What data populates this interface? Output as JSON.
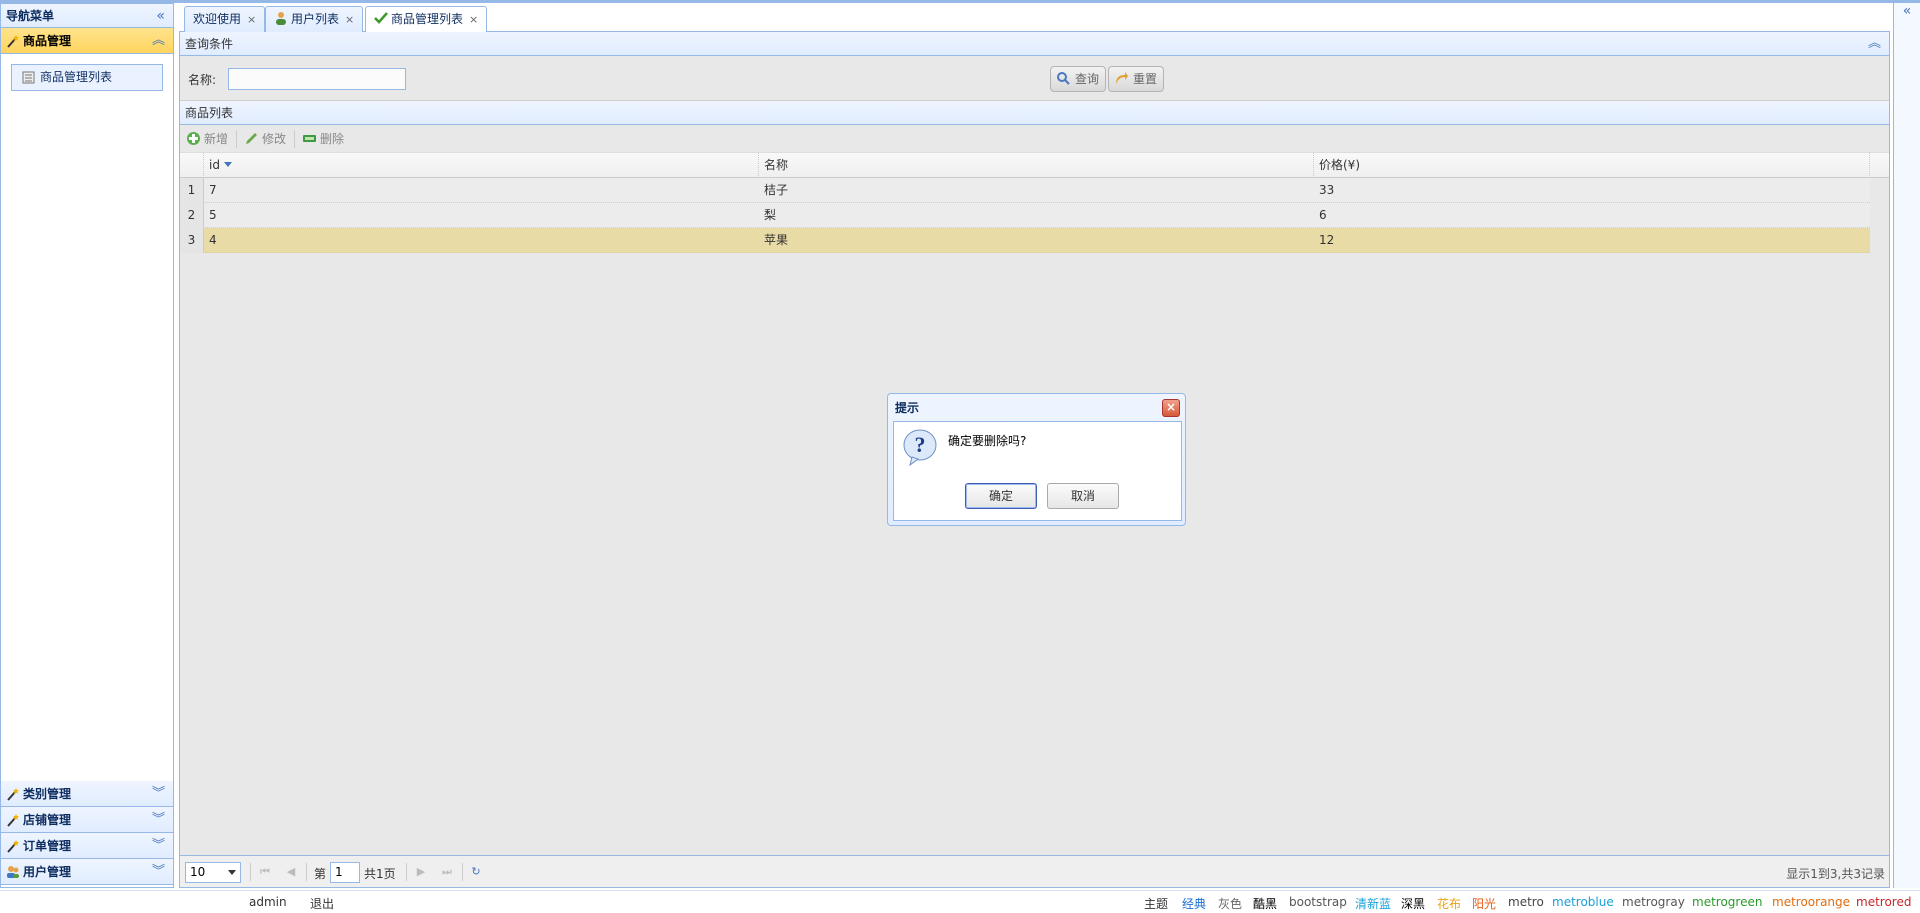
{
  "nav": {
    "title": "导航菜单",
    "sections": [
      {
        "label": "商品管理"
      },
      {
        "label": "类别管理"
      },
      {
        "label": "店铺管理"
      },
      {
        "label": "订单管理"
      },
      {
        "label": "用户管理"
      }
    ],
    "links": [
      {
        "label": "商品管理列表"
      }
    ]
  },
  "tabs": [
    {
      "label": "欢迎使用"
    },
    {
      "label": "用户列表"
    },
    {
      "label": "商品管理列表"
    }
  ],
  "query": {
    "title": "查询条件",
    "name_label": "名称:",
    "name_value": "",
    "search_label": "查询",
    "reset_label": "重置"
  },
  "list": {
    "title": "商品列表",
    "add_label": "新增",
    "edit_label": "修改",
    "delete_label": "删除",
    "columns": [
      "id",
      "名称",
      "价格(¥)"
    ],
    "rows": [
      {
        "num": "1",
        "id": "7",
        "name": "桔子",
        "price": "33"
      },
      {
        "num": "2",
        "id": "5",
        "name": "梨",
        "price": "6"
      },
      {
        "num": "3",
        "id": "4",
        "name": "苹果",
        "price": "12"
      }
    ]
  },
  "pager": {
    "page_size": "10",
    "page_prefix": "第",
    "page_num": "1",
    "page_total": "共1页",
    "info": "显示1到3,共3记录"
  },
  "dialog": {
    "title": "提示",
    "message": "确定要删除吗?",
    "ok_label": "确定",
    "cancel_label": "取消"
  },
  "footer": {
    "user": "admin",
    "logout": "退出",
    "theme_label": "主题",
    "themes": [
      {
        "label": "经典",
        "color": "#1a6fd1"
      },
      {
        "label": "灰色",
        "color": "#666666"
      },
      {
        "label": "酷黑",
        "color": "#000000"
      },
      {
        "label": "bootstrap",
        "color": "#555555"
      },
      {
        "label": "清新蓝",
        "color": "#1aa0d8"
      },
      {
        "label": "深黑",
        "color": "#000000"
      },
      {
        "label": "花布",
        "color": "#e8a317"
      },
      {
        "label": "阳光",
        "color": "#e85a17"
      },
      {
        "label": "metro",
        "color": "#444444"
      },
      {
        "label": "metroblue",
        "color": "#1aa0d8"
      },
      {
        "label": "metrogray",
        "color": "#555555"
      },
      {
        "label": "metrogreen",
        "color": "#2a9a2a"
      },
      {
        "label": "metroorange",
        "color": "#e06d10"
      },
      {
        "label": "metrored",
        "color": "#c62828"
      }
    ]
  }
}
